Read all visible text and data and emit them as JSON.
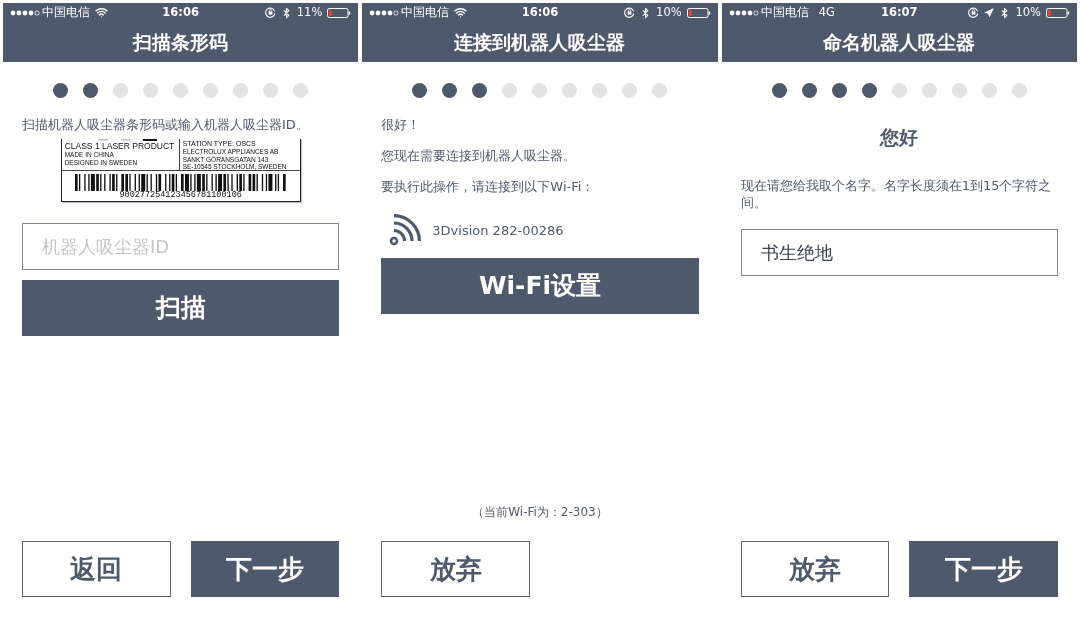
{
  "screens": [
    {
      "status_bar": {
        "carrier": "中国电信",
        "connection": {
          "kind": "wifi"
        },
        "time": "16:06",
        "location": false,
        "battery": "11%"
      },
      "title": "扫描条形码",
      "steps": [
        {
          "done": true
        },
        {
          "done": true
        },
        {
          "done": false
        },
        {
          "done": false
        },
        {
          "done": false
        },
        {
          "done": false
        },
        {
          "done": false
        },
        {
          "done": false
        },
        {
          "done": false
        }
      ],
      "content": [
        {
          "kind": "text",
          "text": "扫描机器人吸尘器条形码或输入机器人吸尘器ID。"
        },
        {
          "kind": "label",
          "title": "CLASS 1 LASER PRODUCT",
          "origin_lines": [
            "MADE IN CHINA",
            "DESIGNED IN SWEDEN"
          ],
          "station": "STATION TYPE: OSCS",
          "address_lines": [
            "ELECTROLUX APPLIANCES AB",
            "SANKT GÖRANSGATAN 143",
            "SE-10545 STOCKHOLM, SWEDEN"
          ],
          "number": "900277254123456781100106"
        },
        {
          "kind": "input",
          "placeholder": "机器人吸尘器ID"
        },
        {
          "kind": "button",
          "label": "扫描"
        }
      ],
      "buttons": [
        {
          "kind": "outline",
          "label": "返回"
        },
        {
          "kind": "filled",
          "label": "下一步"
        }
      ]
    },
    {
      "status_bar": {
        "carrier": "中国电信",
        "connection": {
          "kind": "wifi"
        },
        "time": "16:06",
        "location": false,
        "battery": "10%"
      },
      "title": "连接到机器人吸尘器",
      "steps": [
        {
          "done": true
        },
        {
          "done": true
        },
        {
          "done": true
        },
        {
          "done": false
        },
        {
          "done": false
        },
        {
          "done": false
        },
        {
          "done": false
        },
        {
          "done": false
        },
        {
          "done": false
        }
      ],
      "content": [
        {
          "kind": "text",
          "text": "很好！"
        },
        {
          "kind": "text",
          "text": "您现在需要连接到机器人吸尘器。"
        },
        {
          "kind": "text",
          "text": "要执行此操作，请连接到以下Wi-Fi："
        },
        {
          "kind": "network",
          "name": "3Dvision 282-00286"
        },
        {
          "kind": "button",
          "label": "Wi-Fi设置"
        }
      ],
      "note": "（当前Wi-Fi为：2-303）",
      "buttons": [
        {
          "kind": "outline",
          "label": "放弃"
        }
      ]
    },
    {
      "status_bar": {
        "carrier": "中国电信",
        "connection": {
          "kind": "cellular",
          "label": "4G"
        },
        "time": "16:07",
        "location": true,
        "battery": "10%"
      },
      "title": "命名机器人吸尘器",
      "steps": [
        {
          "done": true
        },
        {
          "done": true
        },
        {
          "done": true
        },
        {
          "done": true
        },
        {
          "done": false
        },
        {
          "done": false
        },
        {
          "done": false
        },
        {
          "done": false
        },
        {
          "done": false
        }
      ],
      "content": [
        {
          "kind": "heading",
          "text": "您好"
        },
        {
          "kind": "text",
          "text": "现在请您给我取个名字。名字长度须在1到15个字符之间。"
        },
        {
          "kind": "input",
          "value": "书生绝地"
        }
      ],
      "buttons": [
        {
          "kind": "outline",
          "label": "放弃"
        },
        {
          "kind": "filled",
          "label": "下一步"
        }
      ]
    }
  ]
}
